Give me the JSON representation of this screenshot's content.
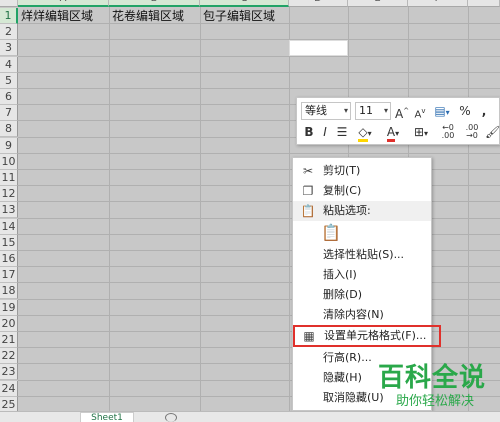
{
  "spreadsheet": {
    "columns": [
      "A",
      "B",
      "C",
      "D",
      "E",
      "F"
    ],
    "rows": [
      "1",
      "2",
      "3",
      "4",
      "5",
      "6",
      "7",
      "8",
      "9",
      "10",
      "11",
      "12",
      "13",
      "14",
      "15",
      "16",
      "17",
      "18",
      "19",
      "20",
      "21",
      "22",
      "23",
      "24",
      "25"
    ],
    "cells": {
      "A1": "烊烊编辑区域",
      "B1": "花卷编辑区域",
      "C1": "包子编辑区域"
    },
    "sheet_tab": "Sheet1"
  },
  "mini_toolbar": {
    "font_name": "等线",
    "font_size": "11",
    "increase_font_label": "A",
    "decrease_font_label": "A",
    "percent_label": "%",
    "comma_label": ",",
    "bold_label": "B",
    "italic_label": "I",
    "font_color_label": "A",
    "decimal_inc_label": "←0 .00",
    "decimal_dec_label": ".00 →0",
    "font_color": "#e0302b",
    "fill_color": "#ffd700"
  },
  "context_menu": {
    "items": [
      {
        "label": "剪切(T)",
        "icon": "scissors-icon"
      },
      {
        "label": "复制(C)",
        "icon": "copy-icon"
      },
      {
        "label": "粘贴选项:",
        "icon": "paste-icon"
      },
      {
        "label": "选择性粘贴(S)...",
        "icon": ""
      },
      {
        "label": "插入(I)",
        "icon": ""
      },
      {
        "label": "删除(D)",
        "icon": ""
      },
      {
        "label": "清除内容(N)",
        "icon": ""
      },
      {
        "label": "设置单元格格式(F)...",
        "icon": "format-cells-icon"
      },
      {
        "label": "行高(R)...",
        "icon": ""
      },
      {
        "label": "隐藏(H)",
        "icon": ""
      },
      {
        "label": "取消隐藏(U)",
        "icon": ""
      }
    ],
    "highlight_color": "#e0302b"
  },
  "watermark": {
    "title": "百科全说",
    "subtitle": "助你轻松解决"
  },
  "accent_color": "#21a366"
}
